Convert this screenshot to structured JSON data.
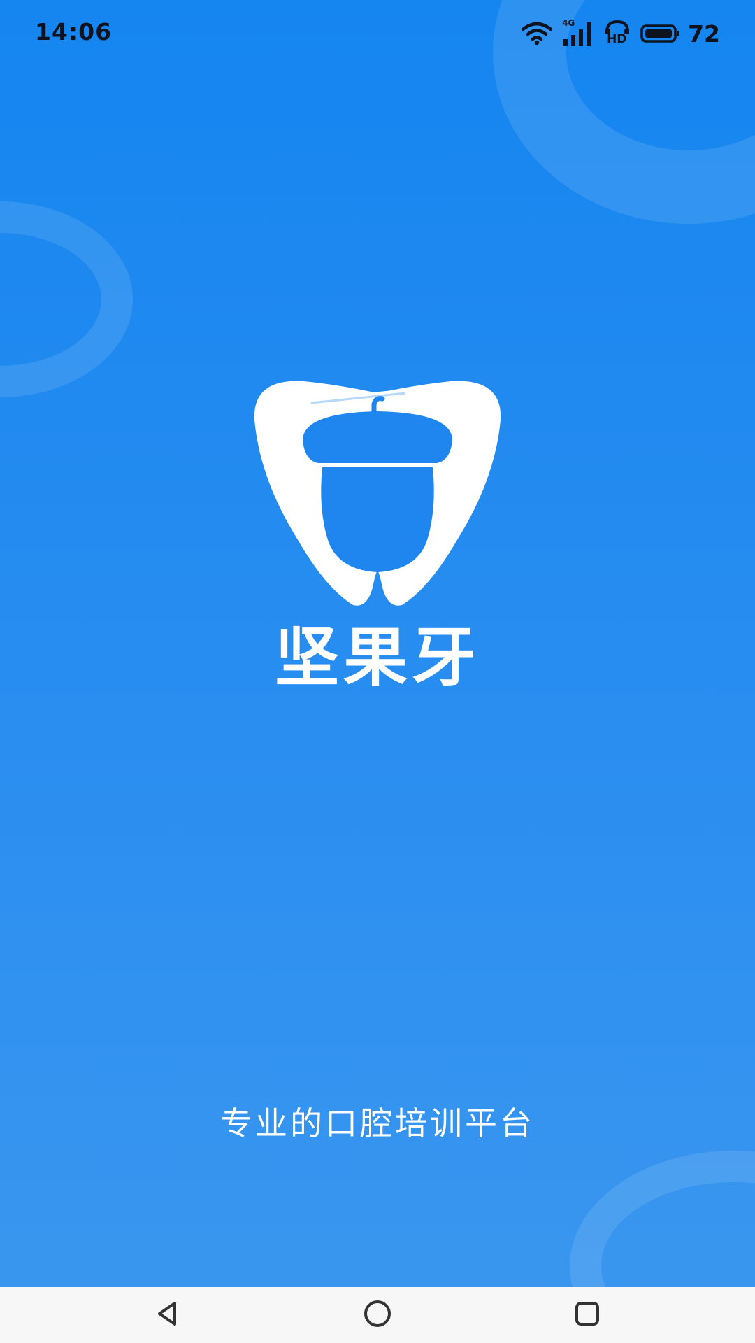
{
  "status_bar": {
    "time": "14:06",
    "battery_level": "72",
    "icons": [
      "wifi-icon",
      "signal-4g-icon",
      "hd-call-icon",
      "battery-icon"
    ],
    "network_label": "4G",
    "hd_label": "HD"
  },
  "splash": {
    "app_name": "坚果牙",
    "slogan": "专业的口腔培训平台",
    "logo_icon": "tooth-acorn-logo-icon"
  },
  "navigation": {
    "icons": [
      "back-icon",
      "home-icon",
      "recent-apps-icon"
    ]
  },
  "colors": {
    "background_top": "#1585f0",
    "background_bottom": "#3b97ef",
    "logo": "#ffffff",
    "nav_bar": "#f7f7f7"
  }
}
